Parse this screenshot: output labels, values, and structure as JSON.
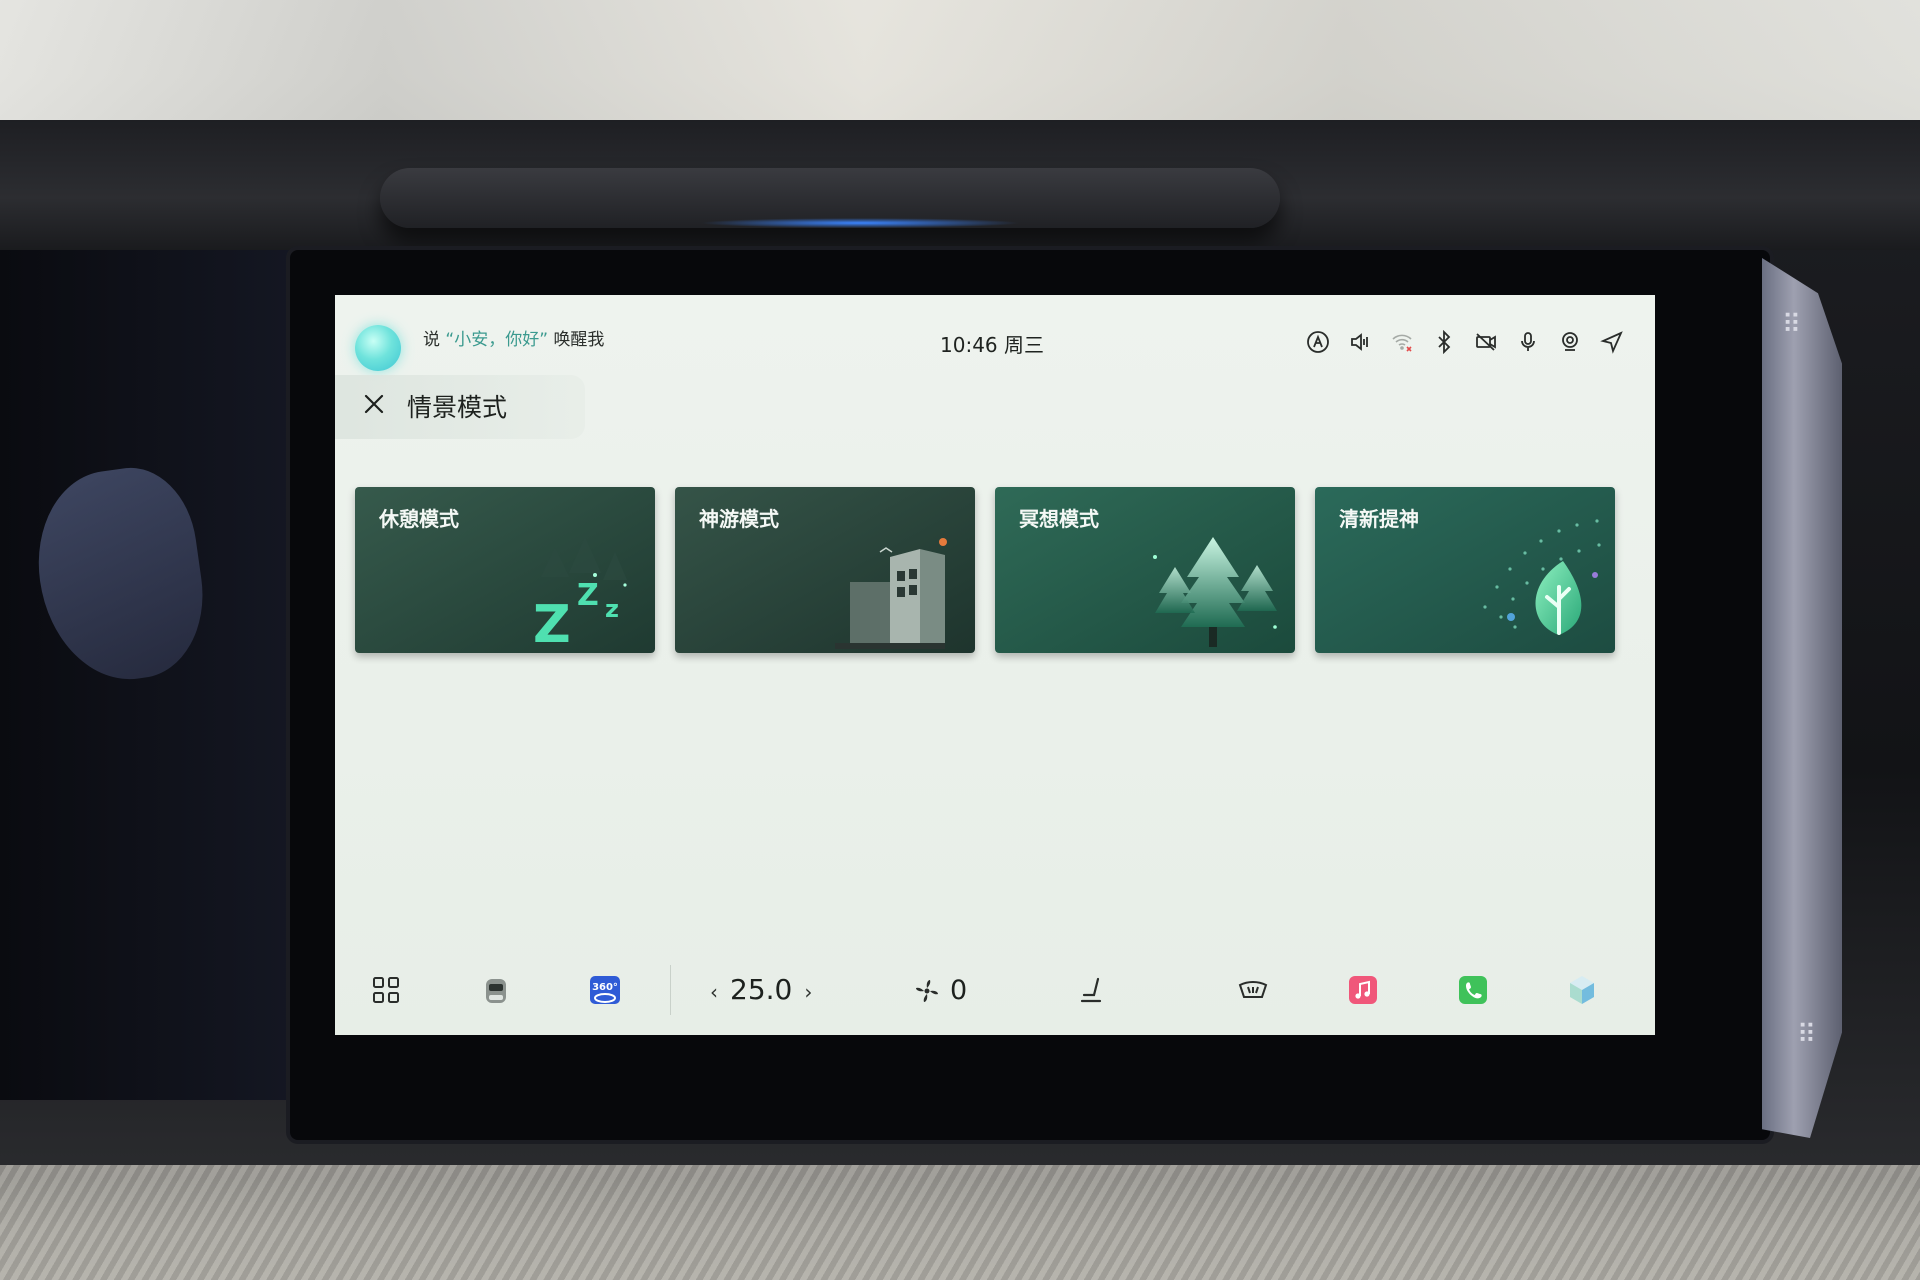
{
  "status_bar": {
    "voice_prefix": "说",
    "voice_quote": "“小安，你好”",
    "voice_suffix": "唤醒我",
    "clock": "10:46 周三",
    "icons": [
      "profile-icon",
      "volume-icon",
      "wifi-off-icon",
      "bluetooth-icon",
      "camera-off-icon",
      "microphone-icon",
      "webcam-icon",
      "navigation-icon"
    ]
  },
  "header": {
    "title": "情景模式"
  },
  "modes": [
    {
      "label": "休憩模式",
      "art": "sleep-zzz"
    },
    {
      "label": "神游模式",
      "art": "city-building"
    },
    {
      "label": "冥想模式",
      "art": "forest-trees"
    },
    {
      "label": "清新提神",
      "art": "fresh-leaf"
    }
  ],
  "dock": {
    "apps_icon": "apps-grid-icon",
    "car_icon": "car-icon",
    "view360_label": "360°",
    "temperature": "25.0",
    "fan_level": "0",
    "seat_icon": "seat-icon",
    "defrost_icon": "defrost-icon",
    "music_icon": "music-icon",
    "phone_icon": "phone-icon",
    "assistant_icon": "assistant-cube-icon"
  },
  "colors": {
    "screen_bg": "#eaf0ea",
    "card_dark": "#2c4a40",
    "accent_teal": "#3b9a8f",
    "music": "#f0577a",
    "phone": "#3fc25a"
  }
}
